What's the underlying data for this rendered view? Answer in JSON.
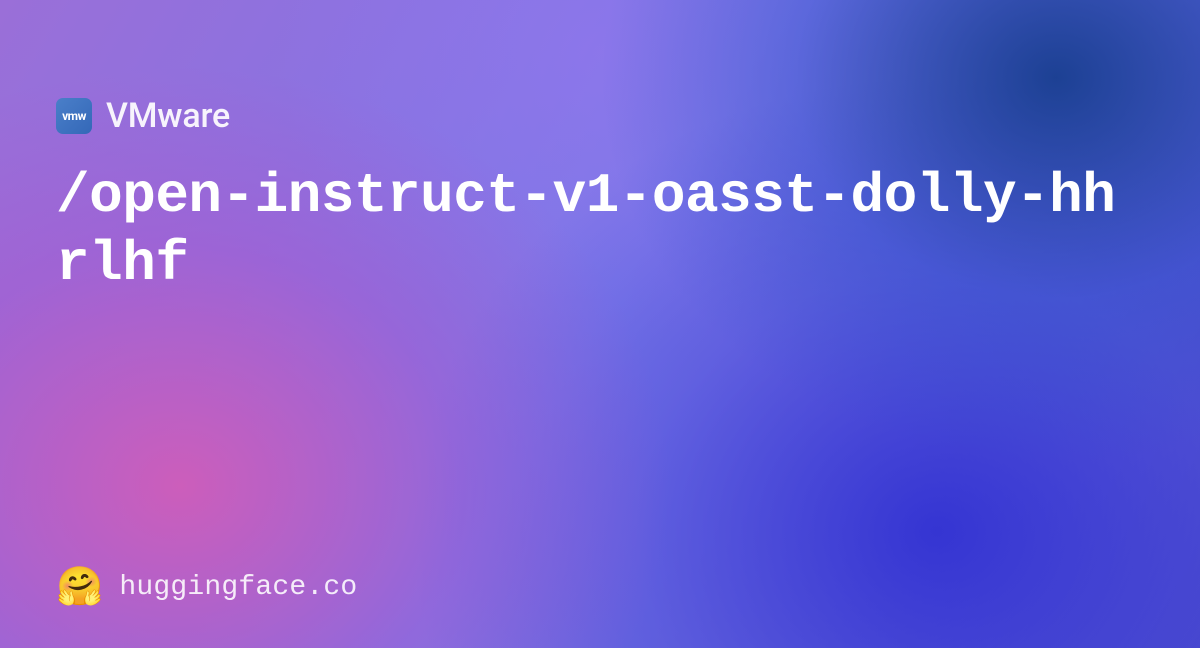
{
  "org": {
    "logo_text": "vmw",
    "name": "VMware"
  },
  "repo": {
    "path": "/open-instruct-v1-oasst-dolly-hhrlhf"
  },
  "footer": {
    "emoji": "🤗",
    "domain": "huggingface.co"
  }
}
